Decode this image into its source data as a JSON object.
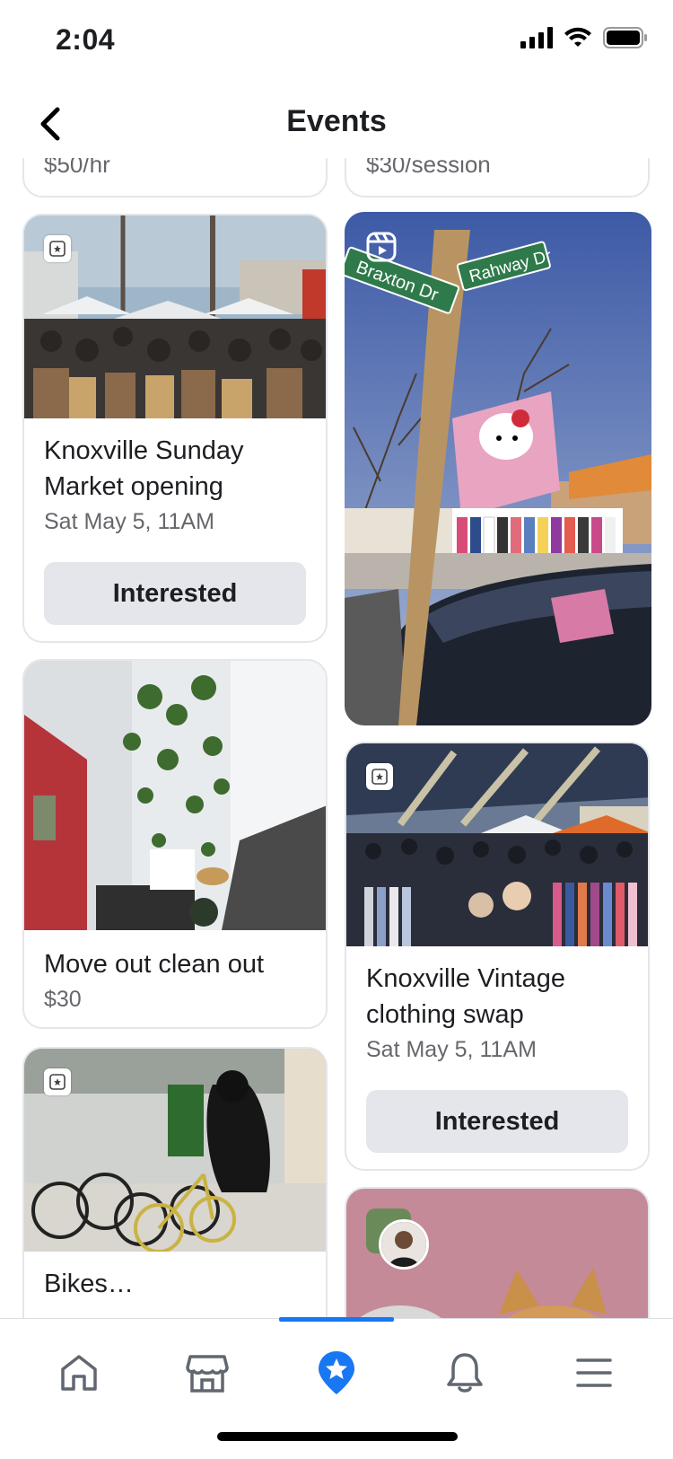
{
  "status": {
    "time": "2:04",
    "icons": [
      "cellular-signal-icon",
      "wifi-icon",
      "battery-icon"
    ]
  },
  "header": {
    "title": "Events",
    "back_icon": "chevron-left-icon"
  },
  "feed": {
    "top_partial": [
      {
        "subtitle": "$50/hr"
      },
      {
        "subtitle": "$30/session"
      }
    ],
    "cards": [
      {
        "id": "knoxville-sunday-market",
        "title": "Knoxville Sunday Market opening",
        "subtitle": "Sat May 5, 11AM",
        "button": "Interested",
        "badge": "event-star-icon"
      },
      {
        "id": "move-out-clean-out",
        "title": "Move out clean out",
        "subtitle": "$30",
        "badge": "event-star-icon"
      },
      {
        "id": "bike-sale",
        "title": "Bikes…",
        "badge": "event-star-icon"
      },
      {
        "id": "hello-kitty-reel",
        "badge": "reels-icon",
        "signs": [
          "Braxton Dr",
          "Rahway Dr"
        ]
      },
      {
        "id": "knoxville-vintage-swap",
        "title": "Knoxville Vintage clothing swap",
        "subtitle": "Sat May 5, 11AM",
        "button": "Interested",
        "badge": "event-star-icon"
      },
      {
        "id": "corgi-post",
        "badge": "avatar"
      }
    ]
  },
  "tabbar": {
    "tabs": [
      {
        "name": "home",
        "icon": "home-icon"
      },
      {
        "name": "marketplace",
        "icon": "store-icon"
      },
      {
        "name": "events",
        "icon": "events-star-icon",
        "active": true
      },
      {
        "name": "notifications",
        "icon": "bell-icon"
      },
      {
        "name": "menu",
        "icon": "menu-icon"
      }
    ]
  },
  "colors": {
    "accent": "#1877f2",
    "button_bg": "#e4e6eb",
    "secondary_text": "#65676b"
  }
}
